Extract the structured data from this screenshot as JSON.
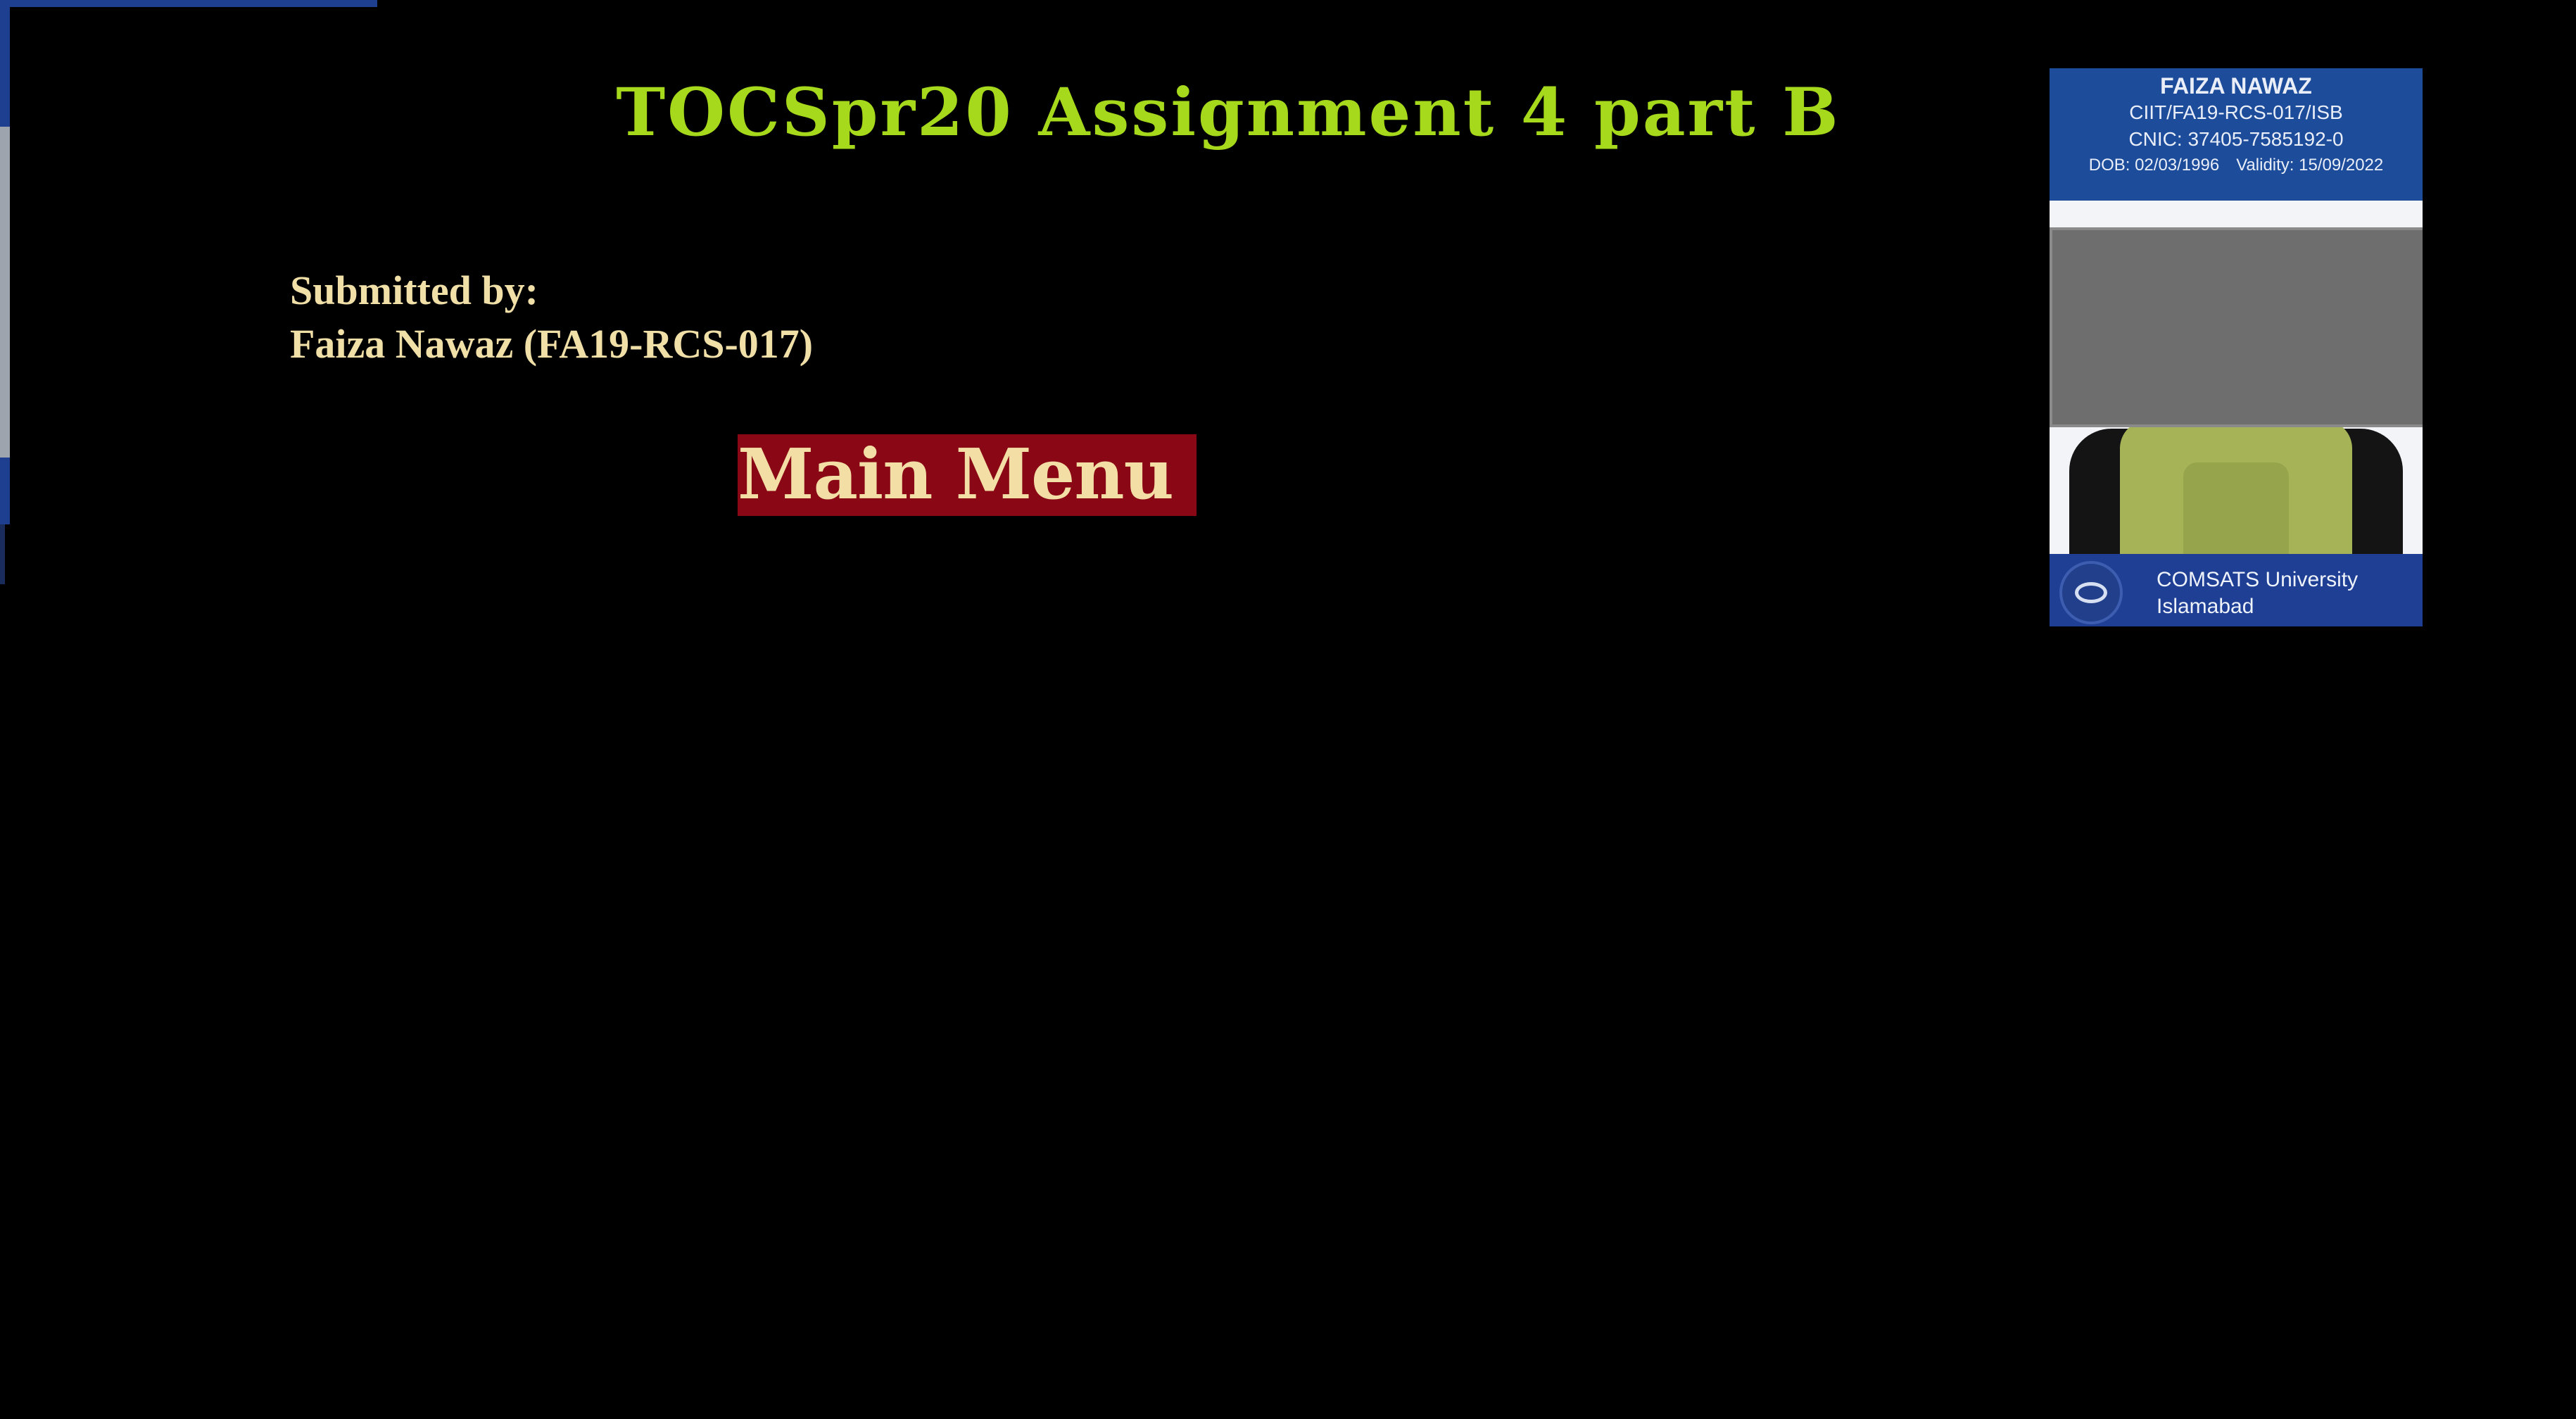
{
  "header": {
    "title": "TOCSpr20 Assignment 4 part B"
  },
  "submission": {
    "label": "Submitted by:",
    "author": "Faiza Nawaz (FA19-RCS-017)"
  },
  "navigation": {
    "main_menu_label": "Main Menu"
  },
  "id_card": {
    "name": "FAIZA NAWAZ",
    "registration": "CIIT/FA19-RCS-017/ISB",
    "cnic": "CNIC: 37405-7585192-0",
    "dob": "DOB: 02/03/1996",
    "validity": "Validity: 15/09/2022",
    "university_line1": "COMSATS University",
    "university_line2": "Islamabad"
  },
  "colors": {
    "background": "#000000",
    "title": "#a6d81c",
    "body_text": "#f1dfa8",
    "button_bg": "#8a0716",
    "card_blue": "#1d4c9b"
  }
}
